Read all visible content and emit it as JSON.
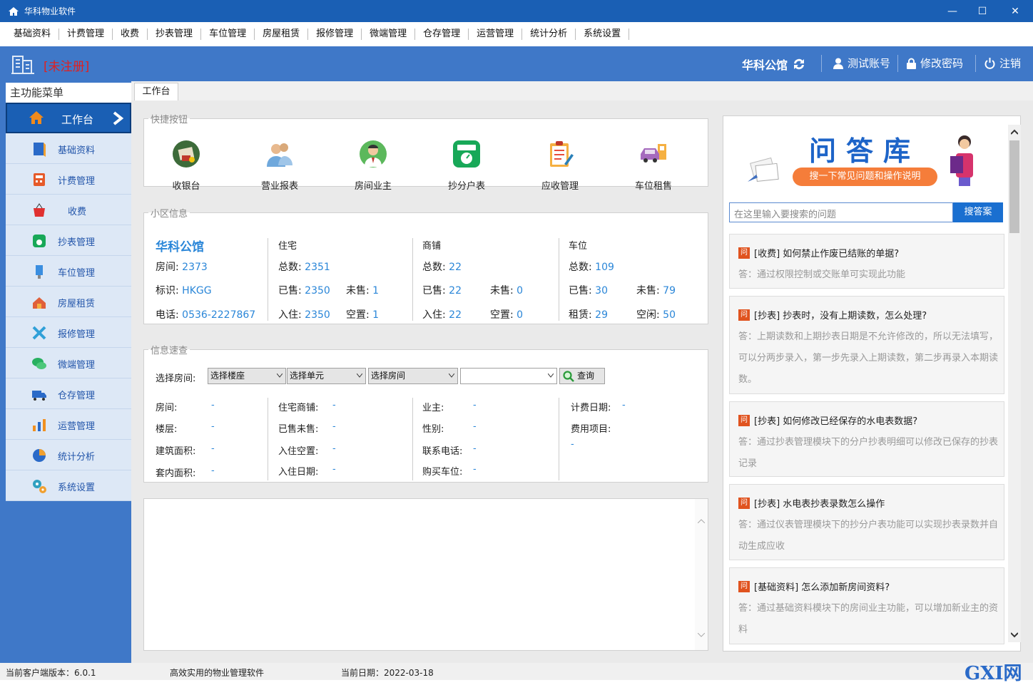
{
  "window": {
    "title": "华科物业软件",
    "minimize": "—",
    "maximize": "☐",
    "close": "✕"
  },
  "menubar": [
    "基础资料",
    "计费管理",
    "收费",
    "抄表管理",
    "车位管理",
    "房屋租赁",
    "报修管理",
    "微端管理",
    "仓存管理",
    "运营管理",
    "统计分析",
    "系统设置"
  ],
  "header": {
    "unregistered": "[未注册]",
    "community": "华科公馆",
    "account": "测试账号",
    "change_password": "修改密码",
    "logout": "注销"
  },
  "sidebar": {
    "title": "主功能菜单",
    "items": [
      {
        "label": "工作台",
        "icon": "home-icon",
        "color": "#f08a1c"
      },
      {
        "label": "基础资料",
        "icon": "book-icon",
        "color": "#2a6ac8"
      },
      {
        "label": "计费管理",
        "icon": "calculator-icon",
        "color": "#e65a2a"
      },
      {
        "label": "收费",
        "icon": "basket-icon",
        "color": "#e03030"
      },
      {
        "label": "抄表管理",
        "icon": "meter-icon",
        "color": "#18a858"
      },
      {
        "label": "车位管理",
        "icon": "parking-icon",
        "color": "#3a8ee0"
      },
      {
        "label": "房屋租赁",
        "icon": "house-rent-icon",
        "color": "#e0603a"
      },
      {
        "label": "报修管理",
        "icon": "tools-icon",
        "color": "#30a0d8"
      },
      {
        "label": "微端管理",
        "icon": "wechat-icon",
        "color": "#28b060"
      },
      {
        "label": "仓存管理",
        "icon": "truck-icon",
        "color": "#2a6ac8"
      },
      {
        "label": "运营管理",
        "icon": "bar-chart-icon",
        "color": "#f09020"
      },
      {
        "label": "统计分析",
        "icon": "pie-chart-icon",
        "color": "#2a6ac8"
      },
      {
        "label": "系统设置",
        "icon": "settings-icon",
        "color": "#30a0c0"
      }
    ]
  },
  "tab": "工作台",
  "quick": {
    "legend": "快捷按钮",
    "buttons": [
      {
        "label": "收银台",
        "icon": "cashier-icon"
      },
      {
        "label": "营业报表",
        "icon": "users-report-icon"
      },
      {
        "label": "房间业主",
        "icon": "owner-icon"
      },
      {
        "label": "抄分户表",
        "icon": "meter-reading-icon"
      },
      {
        "label": "应收管理",
        "icon": "clipboard-icon"
      },
      {
        "label": "车位租售",
        "icon": "car-icon"
      }
    ]
  },
  "community": {
    "legend": "小区信息",
    "name": "华科公馆",
    "room_label": "房间:",
    "room": "2373",
    "code_label": "标识:",
    "code": "HKGG",
    "phone_label": "电话:",
    "phone": "0536-2227867",
    "residential": {
      "title": "住宅",
      "total_label": "总数:",
      "total": "2351",
      "sold_label": "已售:",
      "sold": "2350",
      "unsold_label": "未售:",
      "unsold": "1",
      "occupied_label": "入住:",
      "occupied": "2350",
      "vacant_label": "空置:",
      "vacant": "1"
    },
    "shops": {
      "title": "商铺",
      "total_label": "总数:",
      "total": "22",
      "sold_label": "已售:",
      "sold": "22",
      "unsold_label": "未售:",
      "unsold": "0",
      "occupied_label": "入住:",
      "occupied": "22",
      "vacant_label": "空置:",
      "vacant": "0"
    },
    "parking": {
      "title": "车位",
      "total_label": "总数:",
      "total": "109",
      "sold_label": "已售:",
      "sold": "30",
      "unsold_label": "未售:",
      "unsold": "79",
      "rented_label": "租赁:",
      "rented": "29",
      "idle_label": "空闲:",
      "idle": "50"
    }
  },
  "lookup": {
    "legend": "信息速查",
    "select_room_label": "选择房间:",
    "building": "选择楼座",
    "unit": "选择单元",
    "room": "选择房间",
    "query": "查询",
    "fields": {
      "room": "房间:",
      "floor": "楼层:",
      "area": "建筑面积:",
      "inner_area": "套内面积:",
      "type": "住宅商铺:",
      "sold": "已售未售:",
      "occupied": "入住空置:",
      "move_in_date": "入住日期:",
      "owner": "业主:",
      "gender": "性别:",
      "contact": "联系电话:",
      "parking": "购买车位:",
      "billing_date": "计费日期:",
      "fee_items": "费用项目:"
    },
    "dash": "-"
  },
  "faq": {
    "banner_title": "问答库",
    "banner_subtitle": "搜一下常见问题和操作说明",
    "search_placeholder": "在这里输入要搜索的问题",
    "search_button": "搜答案",
    "badge": "问",
    "items": [
      {
        "q": "[收费] 如何禁止作废已结账的单据?",
        "a": "答：通过权限控制或交账单可实现此功能"
      },
      {
        "q": "[抄表] 抄表时，没有上期读数，怎么处理?",
        "a": "答：上期读数和上期抄表日期是不允许修改的，所以无法填写，可以分两步录入，第一步先录入上期读数，第二步再录入本期读数。"
      },
      {
        "q": "[抄表] 如何修改已经保存的水电表数据?",
        "a": "答：通过抄表管理模块下的分户抄表明细可以修改已保存的抄表记录"
      },
      {
        "q": "[抄表] 水电表抄表录数怎么操作",
        "a": "答：通过仪表管理模块下的抄分户表功能可以实现抄表录数并自动生成应收"
      },
      {
        "q": "[基础资料] 怎么添加新房间资料?",
        "a": "答：通过基础资料模块下的房间业主功能，可以增加新业主的资料"
      }
    ]
  },
  "status": {
    "version": "当前客户端版本：6.0.1",
    "slogan": "高效实用的物业管理软件",
    "date": "当前日期：2022-03-18"
  },
  "watermark": "GXI网"
}
